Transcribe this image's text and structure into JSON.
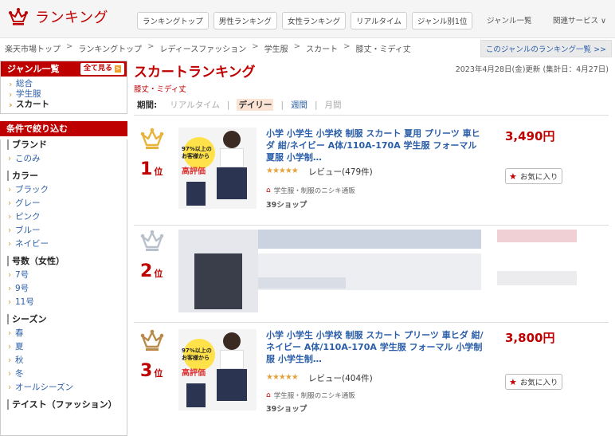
{
  "header": {
    "title": "ランキング",
    "tabs": [
      "ランキングトップ",
      "男性ランキング",
      "女性ランキング",
      "リアルタイム",
      "ジャンル別1位"
    ],
    "genre_list": "ジャンル一覧",
    "related_services": "関連サービス ∨"
  },
  "breadcrumb": [
    "楽天市場トップ",
    "ランキングトップ",
    "レディースファッション",
    "学生服",
    "スカート",
    "膝丈・ミディ丈"
  ],
  "genre_ranking_link": "このジャンルのランキング一覧 >>",
  "sidebar": {
    "genre_title": "ジャンル一覧",
    "see_all": "全て見る",
    "genres": [
      {
        "label": "総合",
        "current": false
      },
      {
        "label": "学生服",
        "current": false
      },
      {
        "label": "スカート",
        "current": true
      }
    ],
    "filter_title": "条件で絞り込む",
    "filters": [
      {
        "title": "ブランド",
        "items": [
          "このみ"
        ]
      },
      {
        "title": "カラー",
        "items": [
          "ブラック",
          "グレー",
          "ピンク",
          "ブルー",
          "ネイビー"
        ]
      },
      {
        "title": "号数（女性）",
        "items": [
          "7号",
          "9号",
          "11号"
        ]
      },
      {
        "title": "シーズン",
        "items": [
          "春",
          "夏",
          "秋",
          "冬",
          "オールシーズン"
        ]
      },
      {
        "title": "テイスト（ファッション）",
        "items": []
      }
    ]
  },
  "main": {
    "page_title": "スカートランキング",
    "subtitle": "膝丈・ミディ丈",
    "updated": "2023年4月28日(金)更新 (集計日：4月27日)",
    "period": {
      "label": "期間:",
      "options": [
        "リアルタイム",
        "デイリー",
        "週間",
        "月間"
      ]
    },
    "items": [
      {
        "rank": "1",
        "rank_suffix": "位",
        "title": "小学 小学生 小学校 制服 スカート 夏用 プリーツ 車ヒダ 紺/ネイビー A体/110A-170A 学生服 フォーマル 夏服 小学制…",
        "price": "3,490円",
        "stars": "★★★★★",
        "review": "レビュー(479件)",
        "shop": "学生服・制服のニシキ通販",
        "shop_count": "39ショップ",
        "fav": "お気に入り",
        "badge_line1": "97%以上の",
        "badge_line2": "お客様から",
        "badge_line3": "高評価"
      },
      {
        "rank": "2",
        "rank_suffix": "位"
      },
      {
        "rank": "3",
        "rank_suffix": "位",
        "title": "小学 小学生 小学校 制服 スカート プリーツ 車ヒダ 紺/ネイビー A体/110A-170A 学生服 フォーマル 小学制服 小学生制…",
        "price": "3,800円",
        "stars": "★★★★★",
        "review": "レビュー(404件)",
        "shop": "学生服・制服のニシキ通販",
        "shop_count": "39ショップ",
        "fav": "お気に入り",
        "badge_line1": "97%以上の",
        "badge_line2": "お客様から",
        "badge_line3": "高評価"
      }
    ]
  },
  "colors": {
    "accent": "#bf0000",
    "link": "#2a5ea8",
    "gold": "#e8b33a",
    "silver": "#b8c0cc",
    "bronze": "#b9894a"
  }
}
